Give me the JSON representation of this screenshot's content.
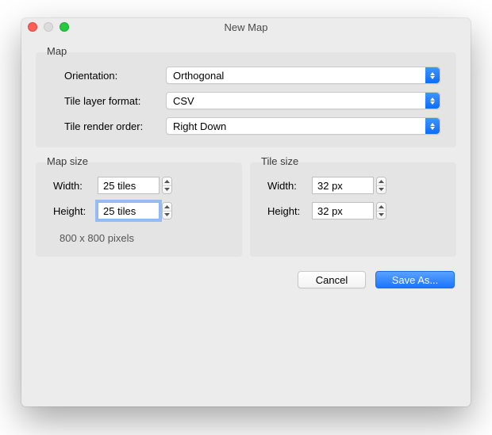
{
  "window": {
    "title": "New Map"
  },
  "map_section": {
    "legend": "Map",
    "orientation_label": "Orientation:",
    "orientation_value": "Orthogonal",
    "tlf_label": "Tile layer format:",
    "tlf_value": "CSV",
    "tro_label": "Tile render order:",
    "tro_value": "Right Down"
  },
  "map_size": {
    "legend": "Map size",
    "width_label": "Width:",
    "width_value": "25 tiles",
    "height_label": "Height:",
    "height_value": "25 tiles",
    "pixel_note": "800 x 800 pixels"
  },
  "tile_size": {
    "legend": "Tile size",
    "width_label": "Width:",
    "width_value": "32 px",
    "height_label": "Height:",
    "height_value": "32 px"
  },
  "buttons": {
    "cancel": "Cancel",
    "save_as": "Save As..."
  }
}
